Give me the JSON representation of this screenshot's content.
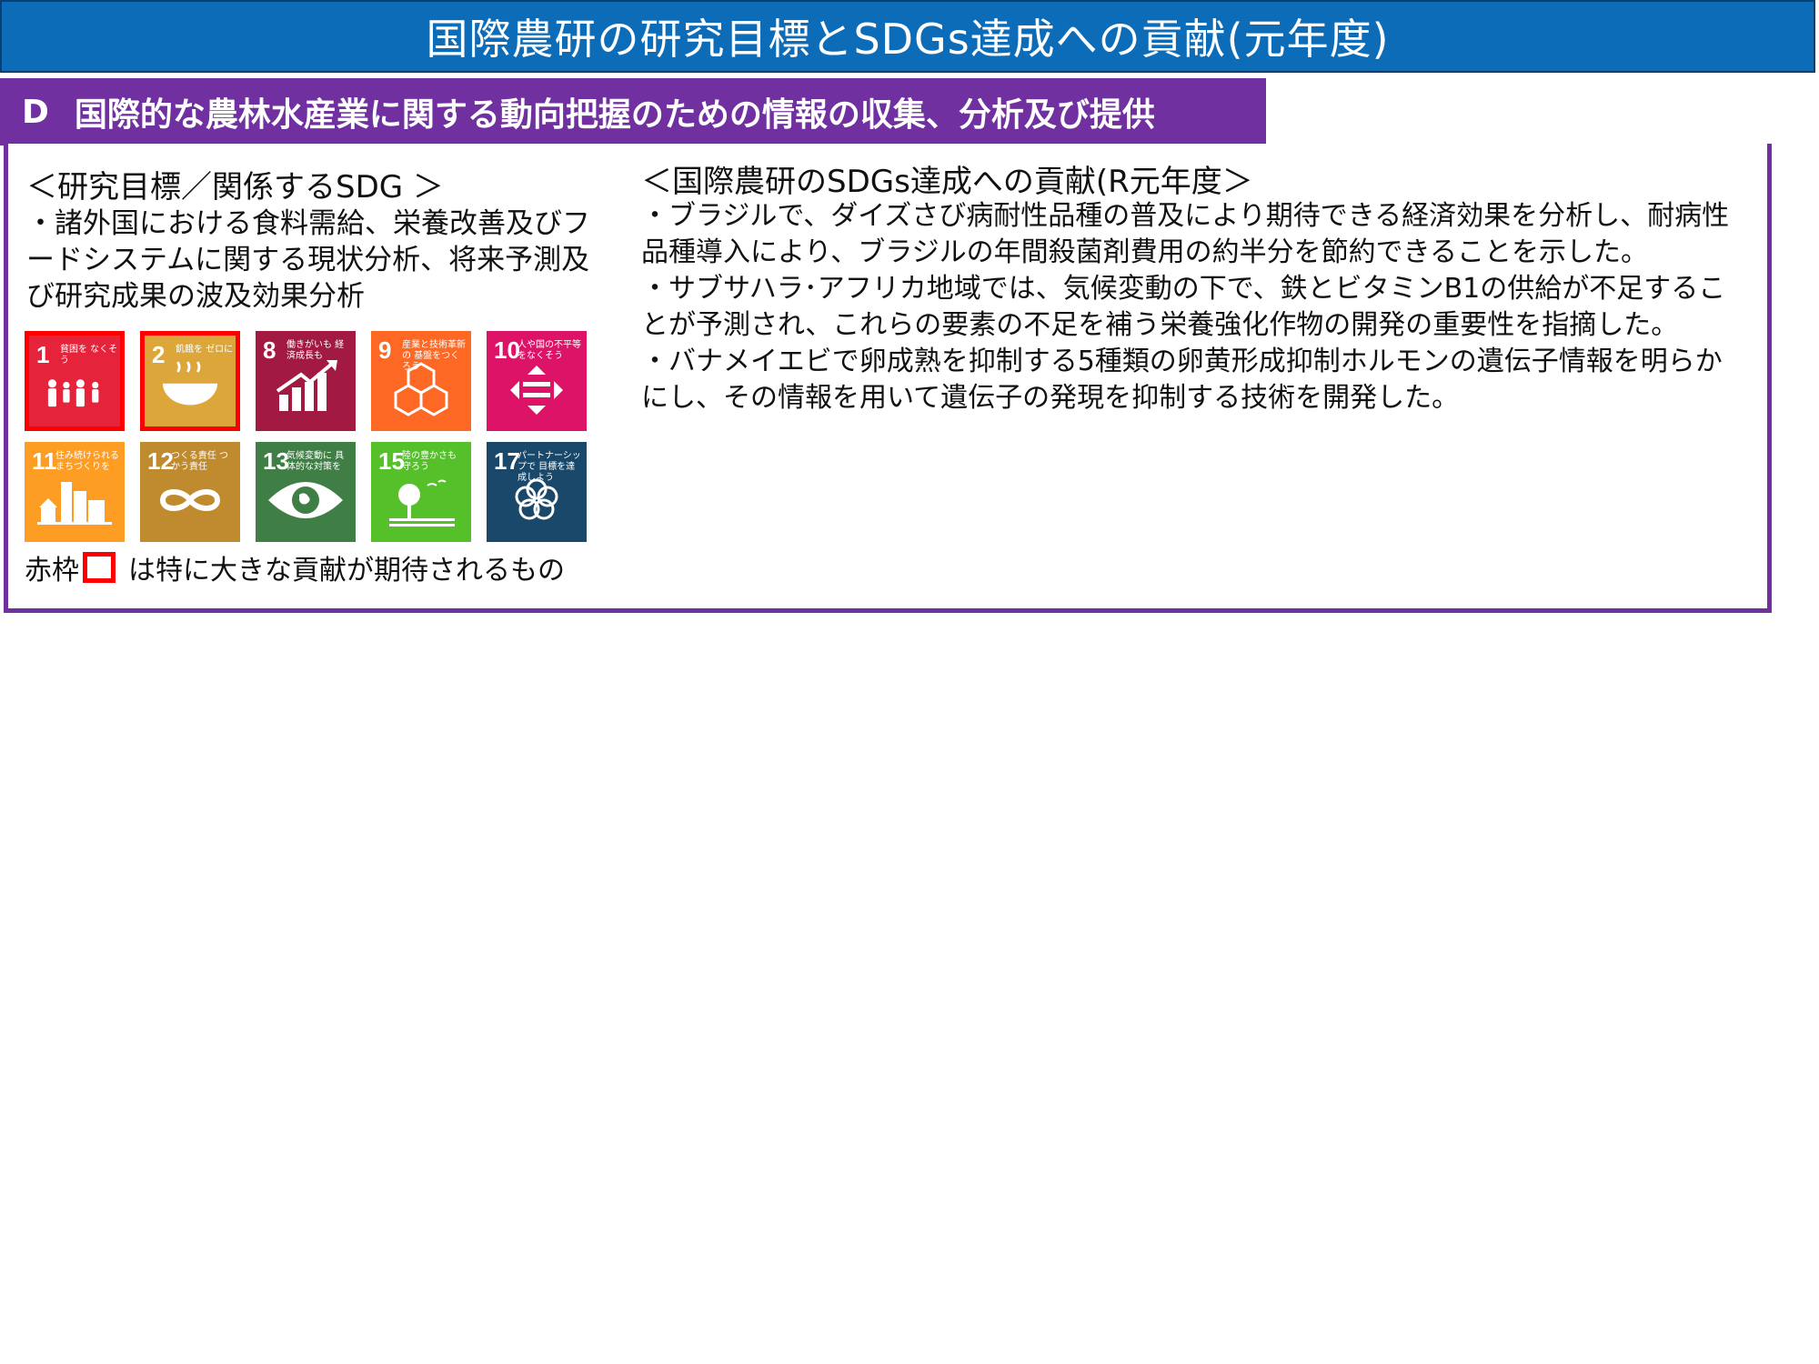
{
  "title": "国際農研の研究目標とSDGs達成への貢献(元年度)",
  "section": {
    "code": "D",
    "title": "国際的な農林水産業に関する動向把握のための情報の収集、分析及び提供"
  },
  "left": {
    "heading": "＜研究目標／関係するSDG ＞",
    "body": "・諸外国における食料需給、栄養改善及びフードシステムに関する現状分析、将来予測及び研究成果の波及効果分析"
  },
  "sdgs": [
    {
      "num": "1",
      "label": "貧困を なくそう",
      "color": "#e5243b",
      "icon": "family-icon",
      "highlight": true
    },
    {
      "num": "2",
      "label": "飢餓を ゼロに",
      "color": "#dda63a",
      "icon": "bowl-icon",
      "highlight": true
    },
    {
      "num": "8",
      "label": "働きがいも 経済成長も",
      "color": "#a21942",
      "icon": "growth-chart-icon",
      "highlight": false
    },
    {
      "num": "9",
      "label": "産業と技術革新の 基盤をつくろう",
      "color": "#fd6925",
      "icon": "cubes-icon",
      "highlight": false
    },
    {
      "num": "10",
      "label": "人や国の不平等 をなくそう",
      "color": "#dd1367",
      "icon": "equality-icon",
      "highlight": false
    },
    {
      "num": "11",
      "label": "住み続けられる まちづくりを",
      "color": "#fd9d24",
      "icon": "city-icon",
      "highlight": false
    },
    {
      "num": "12",
      "label": "つくる責任 つかう責任",
      "color": "#bf8b2e",
      "icon": "infinity-icon",
      "highlight": false
    },
    {
      "num": "13",
      "label": "気候変動に 具体的な対策を",
      "color": "#3f7e44",
      "icon": "eye-globe-icon",
      "highlight": false
    },
    {
      "num": "15",
      "label": "陸の豊かさも 守ろう",
      "color": "#56c02b",
      "icon": "tree-icon",
      "highlight": false
    },
    {
      "num": "17",
      "label": "パートナーシップで 目標を達成しよう",
      "color": "#19486a",
      "icon": "flower-icon",
      "highlight": false
    }
  ],
  "legend": {
    "prefix": "赤枠",
    "suffix": "は特に大きな貢献が期待されるもの"
  },
  "right": {
    "heading": "＜国際農研のSDGs達成への貢献(R元年度＞",
    "items": [
      "・ブラジルで、ダイズさび病耐性品種の普及により期待できる経済効果を分析し、耐病性品種導入により、ブラジルの年間殺菌剤費用の約半分を節約できることを示した。",
      "・サブサハラ･アフリカ地域では、気候変動の下で、鉄とビタミンB1の供給が不足することが予測され、これらの要素の不足を補う栄養強化作物の開発の重要性を指摘した。",
      "・バナメイエビで卵成熟を抑制する5種類の卵黄形成抑制ホルモンの遺伝子情報を明らかにし、その情報を用いて遺伝子の発現を抑制する技術を開発した。"
    ]
  }
}
